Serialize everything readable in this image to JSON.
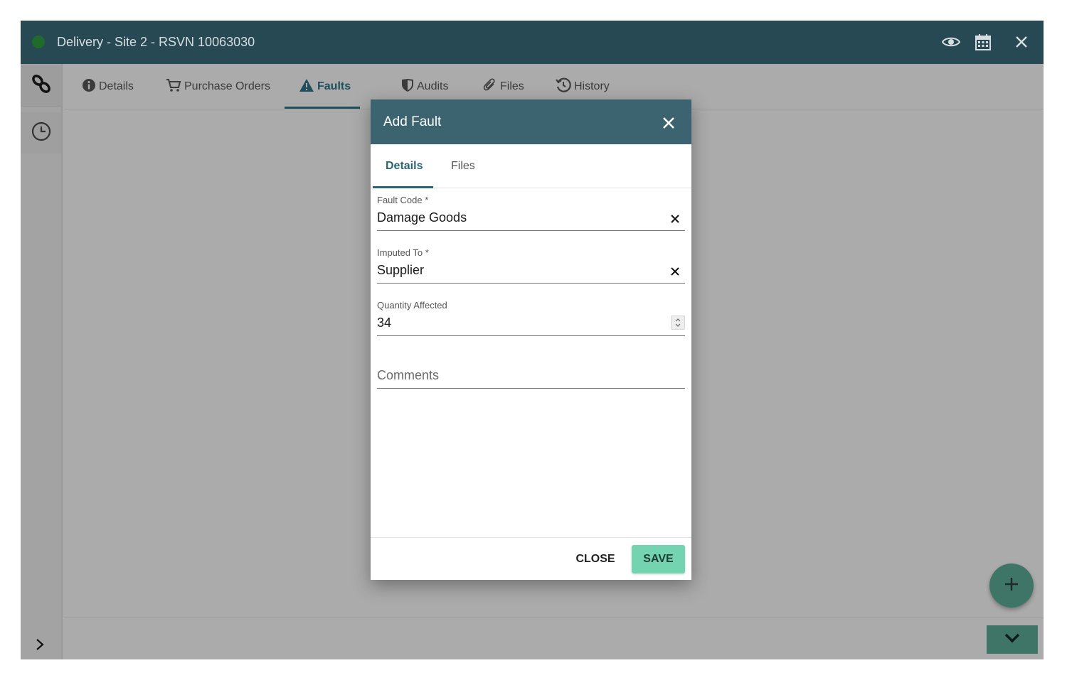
{
  "window": {
    "title": "Delivery - Site 2 - RSVN 10063030",
    "status_color": "#1e6b2a",
    "actions": [
      "eye-icon",
      "calendar-icon",
      "close-icon"
    ]
  },
  "sidebar": {
    "items": [
      {
        "icon": "link-icon"
      },
      {
        "icon": "clock-icon"
      }
    ],
    "expand_icon": "chevron-right-icon"
  },
  "tabs": [
    {
      "label": "Details",
      "icon": "info-icon"
    },
    {
      "label": "Purchase Orders",
      "icon": "cart-icon"
    },
    {
      "label": "Faults",
      "icon": "warning-icon",
      "active": true
    },
    {
      "label": "Audits",
      "icon": "shield-icon"
    },
    {
      "label": "Files",
      "icon": "paperclip-icon"
    },
    {
      "label": "History",
      "icon": "history-icon"
    }
  ],
  "dialog": {
    "title": "Add Fault",
    "tabs": [
      {
        "label": "Details",
        "active": true
      },
      {
        "label": "Files"
      }
    ],
    "fields": {
      "fault_code": {
        "label": "Fault Code *",
        "value": "Damage Goods"
      },
      "imputed_to": {
        "label": "Imputed To *",
        "value": "Supplier"
      },
      "quantity": {
        "label": "Quantity Affected",
        "value": "34"
      },
      "comments": {
        "placeholder": "Comments"
      }
    },
    "buttons": {
      "close_label": "CLOSE",
      "save_label": "SAVE"
    }
  },
  "colors": {
    "header": "#264953",
    "dialog_header": "#3b6470",
    "accent": "#2b6474",
    "save": "#74d3b1",
    "fab": "#3e7566"
  }
}
